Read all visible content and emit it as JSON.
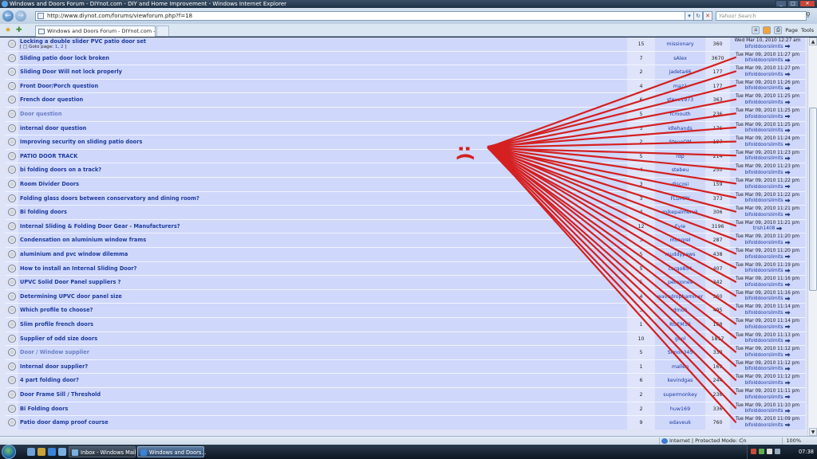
{
  "window": {
    "title": "Windows and Doors Forum - DIYnot.com - DIY and Home Improvement - Windows Internet Explorer",
    "controls": [
      "_",
      "□",
      "✕"
    ]
  },
  "address": {
    "url": "http://www.diynot.com/forums/viewforum.php?f=18"
  },
  "search": {
    "placeholder": "Yahoo! Search"
  },
  "tabs": {
    "active_label": "Windows and Doors Forum - DIYnot.com - DIY a..."
  },
  "command_bar": {
    "page_label": "Page",
    "tools_label": "Tools"
  },
  "topics": [
    {
      "title": "Locking a double slider PVC patio door set",
      "goto": "Goto page:",
      "pages": [
        "1",
        "2"
      ],
      "replies": "15",
      "author": "missionary",
      "views": "360",
      "last_date": "Wed Mar 10, 2010 12:27 am",
      "last_user": "bifolddoorslimits",
      "visited": false
    },
    {
      "title": "Sliding patio door lock broken",
      "replies": "7",
      "author": "sAlex",
      "views": "3670",
      "last_date": "Tue Mar 09, 2010 11:27 pm",
      "last_user": "bifolddoorslimits",
      "visited": false
    },
    {
      "title": "Sliding Door Will not lock properly",
      "replies": "2",
      "author": "jadeta46",
      "views": "177",
      "last_date": "Tue Mar 09, 2010 11:27 pm",
      "last_user": "bifolddoorslimits",
      "visited": false
    },
    {
      "title": "Front Door/Porch question",
      "replies": "4",
      "author": "maz1",
      "views": "177",
      "last_date": "Tue Mar 09, 2010 11:26 pm",
      "last_user": "bifolddoorslimits",
      "visited": false
    },
    {
      "title": "French door question",
      "replies": "6",
      "author": "steve1973",
      "views": "363",
      "last_date": "Tue Mar 09, 2010 11:25 pm",
      "last_user": "bifolddoorslimits",
      "visited": false
    },
    {
      "title": "Door question",
      "replies": "5",
      "author": "rcmouth",
      "views": "236",
      "last_date": "Tue Mar 09, 2010 11:25 pm",
      "last_user": "bifolddoorslimits",
      "visited": true
    },
    {
      "title": "internal door question",
      "replies": "3",
      "author": "idlehands",
      "views": "176",
      "last_date": "Tue Mar 09, 2010 11:25 pm",
      "last_user": "bifolddoorslimits",
      "visited": false
    },
    {
      "title": "Improving security on sliding patio doors",
      "replies": "2",
      "author": "SteveOM",
      "views": "197",
      "last_date": "Tue Mar 09, 2010 11:24 pm",
      "last_user": "bifolddoorslimits",
      "visited": false
    },
    {
      "title": "PATIO DOOR TRACK",
      "replies": "5",
      "author": "rdp",
      "views": "214",
      "last_date": "Tue Mar 09, 2010 11:23 pm",
      "last_user": "bifolddoorslimits",
      "visited": false
    },
    {
      "title": "bi folding doors on a track?",
      "replies": "4",
      "author": "stebeu",
      "views": "250",
      "last_date": "Tue Mar 09, 2010 11:23 pm",
      "last_user": "bifolddoorslimits",
      "visited": false
    },
    {
      "title": "Room Divider Doors",
      "replies": "3",
      "author": "discosi",
      "views": "159",
      "last_date": "Tue Mar 09, 2010 11:22 pm",
      "last_user": "bifolddoorslimits",
      "visited": false
    },
    {
      "title": "Folding glass doors between conservatory and dining room?",
      "replies": "3",
      "author": "FLUMPY",
      "views": "373",
      "last_date": "Tue Mar 09, 2010 11:22 pm",
      "last_user": "bifolddoorslimits",
      "visited": false
    },
    {
      "title": "Bi folding doors",
      "replies": "4",
      "author": "mikepalmeruk",
      "views": "306",
      "last_date": "Tue Mar 09, 2010 11:21 pm",
      "last_user": "bifolddoorslimits",
      "visited": false
    },
    {
      "title": "Internal Sliding & Folding Door Gear - Manufacturers?",
      "replies": "12",
      "author": "Evie",
      "views": "3196",
      "last_date": "Tue Mar 09, 2010 11:21 pm",
      "last_user": "trish1408",
      "visited": false
    },
    {
      "title": "Condensation on aluminium window frams",
      "replies": "3",
      "author": "mongrel",
      "views": "287",
      "last_date": "Tue Mar 09, 2010 11:20 pm",
      "last_user": "bifolddoorslimits",
      "visited": false
    },
    {
      "title": "aluminium and pvc window dilemma",
      "replies": "5",
      "author": "muddypaws",
      "views": "438",
      "last_date": "Tue Mar 09, 2010 11:20 pm",
      "last_user": "bifolddoorslimits",
      "visited": false
    },
    {
      "title": "How to install an Internal Sliding Door?",
      "replies": "5",
      "author": "cargo854",
      "views": "407",
      "last_date": "Tue Mar 09, 2010 11:19 pm",
      "last_user": "bifolddoorslimits",
      "visited": false
    },
    {
      "title": "UPVC Solid Door Panel suppliers ?",
      "replies": "5",
      "author": "petejones",
      "views": "342",
      "last_date": "Tue Mar 09, 2010 11:16 pm",
      "last_user": "bifolddoorslimits",
      "visited": false
    },
    {
      "title": "Determining UPVC door panel size",
      "replies": "4",
      "author": "wavedrophammer",
      "views": "360",
      "last_date": "Tue Mar 09, 2010 11:16 pm",
      "last_user": "bifolddoorslimits",
      "visited": false
    },
    {
      "title": "Which profile to choose?",
      "replies": "3",
      "author": "dmob",
      "views": "495",
      "last_date": "Tue Mar 09, 2010 11:14 pm",
      "last_user": "bifolddoorslimits",
      "visited": false
    },
    {
      "title": "Slim profile french doors",
      "replies": "1",
      "author": "ROEM13",
      "views": "168",
      "last_date": "Tue Mar 09, 2010 11:14 pm",
      "last_user": "bifolddoorslimits",
      "visited": false
    },
    {
      "title": "Supplier of odd size doors",
      "replies": "10",
      "author": "gool",
      "views": "1817",
      "last_date": "Tue Mar 09, 2010 11:13 pm",
      "last_user": "bifolddoorslimits",
      "visited": false
    },
    {
      "title": "Door / Window supplier",
      "replies": "5",
      "author": "Simon345",
      "views": "338",
      "last_date": "Tue Mar 09, 2010 11:12 pm",
      "last_user": "bifolddoorslimits",
      "visited": true
    },
    {
      "title": "Internal door supplier?",
      "replies": "1",
      "author": "mallen",
      "views": "169",
      "last_date": "Tue Mar 09, 2010 11:12 pm",
      "last_user": "bifolddoorslimits",
      "visited": false
    },
    {
      "title": "4 part folding door?",
      "replies": "6",
      "author": "kevindgas",
      "views": "244",
      "last_date": "Tue Mar 09, 2010 11:12 pm",
      "last_user": "bifolddoorslimits",
      "visited": false
    },
    {
      "title": "Door Frame Sill / Threshold",
      "replies": "2",
      "author": "supermonkey",
      "views": "236",
      "last_date": "Tue Mar 09, 2010 11:11 pm",
      "last_user": "bifolddoorslimits",
      "visited": false
    },
    {
      "title": "Bi Folding doors",
      "replies": "2",
      "author": "huw169",
      "views": "336",
      "last_date": "Tue Mar 09, 2010 11:10 pm",
      "last_user": "bifolddoorslimits",
      "visited": false
    },
    {
      "title": "Patio door damp proof course",
      "replies": "9",
      "author": "edaveuk",
      "views": "760",
      "last_date": "Tue Mar 09, 2010 11:09 pm",
      "last_user": "bifolddoorslimits",
      "visited": false
    }
  ],
  "annotation": {
    "frown_text": ":(",
    "color": "#d42020"
  },
  "status": {
    "zone": "Internet | Protected Mode: On",
    "zoom": "100%"
  },
  "taskbar": {
    "tasks": [
      "Inbox - Windows Mail",
      "Windows and Doors..."
    ],
    "clock": "07:38"
  }
}
